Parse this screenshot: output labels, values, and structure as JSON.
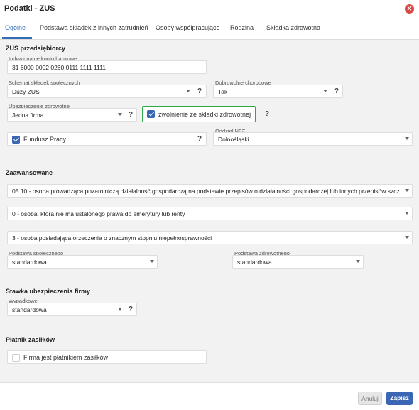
{
  "window": {
    "title": "Podatki - ZUS"
  },
  "tabs": [
    {
      "label": "Ogólne"
    },
    {
      "label": "Podstawa składek z innych zatrudnień"
    },
    {
      "label": "Osoby współpracujące"
    },
    {
      "label": "Rodzina"
    },
    {
      "label": "Składka zdrowotna"
    }
  ],
  "zus": {
    "section_title": "ZUS przedsiębiorcy",
    "bank_account": {
      "label": "Indywidualne konto bankowe",
      "value": "31 6000 0002 0260 0111 1111 1111"
    },
    "social_scheme": {
      "label": "Schemat składek społecznych",
      "value": "Duży ZUS",
      "help": "?"
    },
    "voluntary_sickness": {
      "label": "Dobrowolne chorobowe",
      "value": "Tak",
      "help": "?"
    },
    "health_insurance": {
      "label": "Ubezpieczenie zdrowotne",
      "value": "Jedna firma",
      "help": "?"
    },
    "health_exemption": {
      "label": "zwolnienie ze składki zdrowotnej",
      "checked": true,
      "help": "?"
    },
    "labor_fund": {
      "label": "Fundusz Pracy",
      "checked": true,
      "help": "?"
    },
    "nfz_branch": {
      "label": "Oddział NFZ",
      "value": "Dolnośląski"
    }
  },
  "advanced": {
    "section_title": "Zaawansowane",
    "code1": "05 10 - osoba prowadząca pozarolniczą działalność gospodarczą na podstawie przepisów o działalności gospodarczej lub innych przepisów szcz...",
    "code2": "0 - osoba, która nie ma ustalonego prawa do emerytury lub renty",
    "code3": "3 - osoba posiadająca orzeczenie o znacznym stopniu niepełnosprawności",
    "social_base": {
      "label": "Podstawa społecznego",
      "value": "standardowa"
    },
    "health_base": {
      "label": "Podstawa zdrowotnego",
      "value": "standardowa"
    }
  },
  "company_rate": {
    "section_title": "Stawka ubezpieczenia firmy",
    "accident": {
      "label": "Wypadkowe",
      "value": "standardowa",
      "help": "?"
    }
  },
  "payer": {
    "section_title": "Płatnik zasiłków",
    "is_payer": {
      "label": "Firma jest płatnikiem zasiłków",
      "checked": false
    }
  },
  "footer": {
    "cancel_label": "Anuluj",
    "save_label": "Zapisz"
  },
  "colors": {
    "accent": "#3a66b4",
    "highlight": "#2eaa4a",
    "close": "#e04545"
  }
}
